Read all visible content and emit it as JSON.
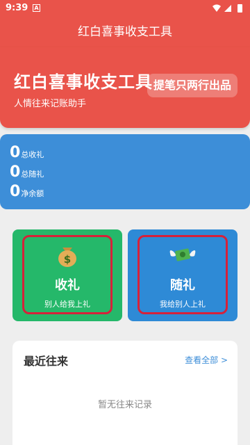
{
  "status_bar": {
    "time": "9:39",
    "notification_badge": "A",
    "icons": [
      "wifi-icon",
      "signal-icon",
      "battery-icon"
    ]
  },
  "app_bar": {
    "title": "红白喜事收支工具"
  },
  "hero": {
    "title": "红白喜事收支工具",
    "subtitle": "人情往来记账助手",
    "badge": "提笔只两行出品"
  },
  "stats": {
    "items": [
      {
        "value": "0",
        "label": "总收礼"
      },
      {
        "value": "0",
        "label": "总随礼"
      },
      {
        "value": "0",
        "label": "净余额"
      }
    ]
  },
  "actions": {
    "receive": {
      "title": "收礼",
      "desc": "别人给我上礼",
      "icon": "money-bag-icon"
    },
    "give": {
      "title": "随礼",
      "desc": "我给别人上礼",
      "icon": "money-with-wings-icon"
    }
  },
  "recent": {
    "title": "最近往来",
    "view_all": "查看全部 >",
    "empty": "暂无往来记录"
  },
  "colors": {
    "primary_red": "#e9534a",
    "stats_blue": "#3d8ed8",
    "receive_green": "#25b86a",
    "give_blue": "#2e8ad6",
    "highlight_outline": "#d6213a"
  }
}
